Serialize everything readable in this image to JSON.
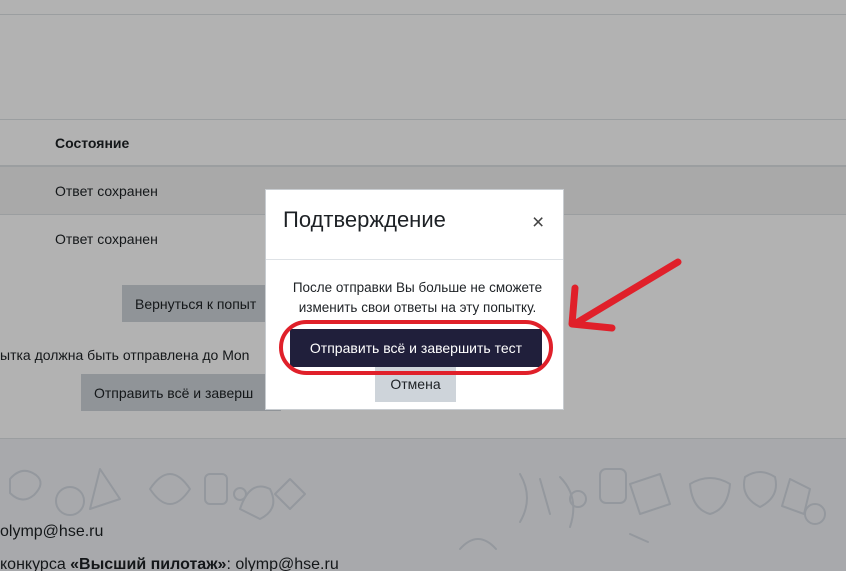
{
  "table": {
    "header_status": "Состояние",
    "rows": [
      {
        "status": "Ответ сохранен"
      },
      {
        "status": "Ответ сохранен"
      }
    ]
  },
  "page": {
    "return_button_label": "Вернуться к попыт",
    "deadline_text": "ытка должна быть отправлена до Mon",
    "submit_button_label": "Отправить всё и заверш"
  },
  "footer": {
    "email_line": "olymp@hse.ru",
    "contest_prefix": "конкурса ",
    "contest_name": "«Высший пилотаж»",
    "contest_suffix": ": olymp@hse.ru"
  },
  "modal": {
    "title": "Подтверждение",
    "close_symbol": "×",
    "body_text": "После отправки Вы больше не сможете изменить свои ответы на эту попытку.",
    "submit_label": "Отправить всё и завершить тест",
    "cancel_label": "Отмена"
  },
  "annotation": {
    "color": "#e0202a"
  }
}
